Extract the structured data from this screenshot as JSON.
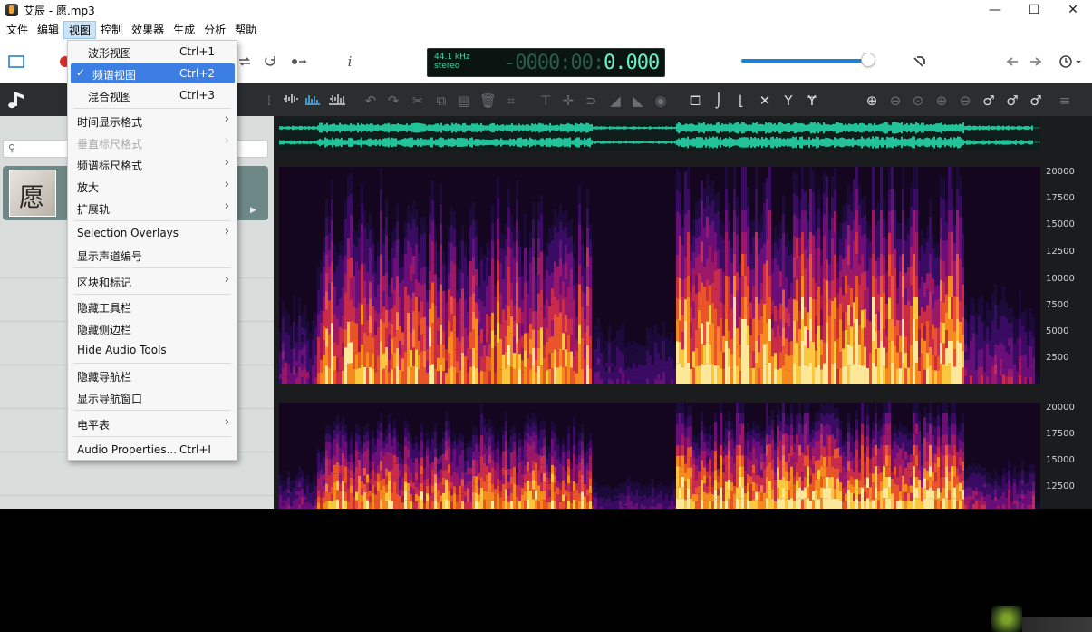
{
  "window": {
    "title": "艾辰 - 愿.mp3",
    "minimize": "—",
    "maximize": "☐",
    "close": "✕"
  },
  "menubar": {
    "items": [
      "文件",
      "编辑",
      "视图",
      "控制",
      "效果器",
      "生成",
      "分析",
      "帮助"
    ],
    "active_index": 2
  },
  "display": {
    "sample_rate": "44.1 kHz",
    "channels": "stereo",
    "time_dim": "-0000:00:0",
    "time_bright": "0.000"
  },
  "toolbar": {
    "info_glyph": "i"
  },
  "view_menu": {
    "items": [
      {
        "label": "波形视图",
        "shortcut": "Ctrl+1"
      },
      {
        "label": "频谱视图",
        "shortcut": "Ctrl+2",
        "checked": true
      },
      {
        "label": "混合视图",
        "shortcut": "Ctrl+3"
      },
      {
        "label": "时间显示格式",
        "submenu": true
      },
      {
        "label": "垂直标尺格式",
        "submenu": true,
        "disabled": true
      },
      {
        "label": "频谱标尺格式",
        "submenu": true
      },
      {
        "label": "放大",
        "submenu": true
      },
      {
        "label": "扩展轨",
        "submenu": true
      },
      {
        "label": "Selection Overlays",
        "submenu": true
      },
      {
        "label": "显示声道编号"
      },
      {
        "label": "区块和标记",
        "submenu": true
      },
      {
        "label": "隐藏工具栏"
      },
      {
        "label": "隐藏侧边栏"
      },
      {
        "label": "Hide Audio Tools"
      },
      {
        "label": "隐藏导航栏"
      },
      {
        "label": "显示导航窗口"
      },
      {
        "label": "电平表",
        "submenu": true
      },
      {
        "label": "Audio Properties...",
        "shortcut": "Ctrl+I"
      }
    ],
    "check_glyph": "✓",
    "arrow_glyph": "›"
  },
  "sidebar": {
    "album_glyph": "愿"
  },
  "frequency_scale": {
    "channel1": [
      "20000",
      "17500",
      "15000",
      "12500",
      "10000",
      "7500",
      "5000",
      "2500"
    ],
    "channel2": [
      "20000",
      "17500",
      "15000",
      "12500"
    ]
  },
  "colors": {
    "accent": "#3d7ee3",
    "waveform": "#22c39a",
    "display_text": "#6cf0c8"
  }
}
